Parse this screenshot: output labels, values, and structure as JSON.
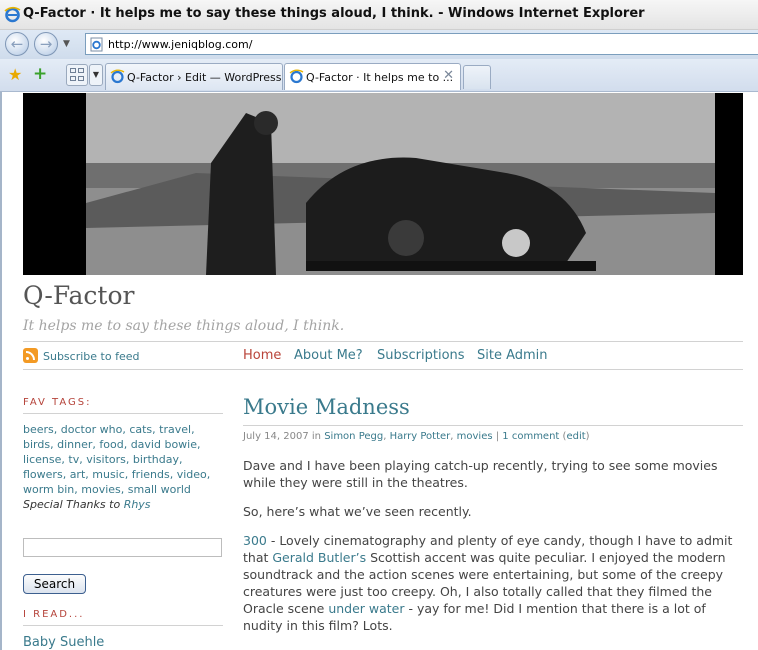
{
  "browser": {
    "window_title": "Q-Factor · It helps me to say these things aloud, I think. - Windows Internet Explorer",
    "address": "http://www.jeniqblog.com/",
    "tabs": [
      {
        "label": "Q-Factor › Edit — WordPress",
        "active": false
      },
      {
        "label": "Q-Factor · It helps me to ...",
        "active": true
      }
    ],
    "back_icon": "back-arrow-icon",
    "forward_icon": "forward-arrow-icon",
    "tab_close_icon": "close-icon"
  },
  "site": {
    "title": "Q-Factor",
    "description": "It helps me to say these things aloud, I think.",
    "feed_link": "Subscribe to feed"
  },
  "nav": [
    "Home",
    "About Me?",
    "Subscriptions",
    "Site Admin"
  ],
  "sidebar": {
    "fav_tags_heading": "FAV TAGS:",
    "tags": [
      "beers",
      "doctor who",
      "cats",
      "travel",
      "birds",
      "dinner",
      "food",
      "david bowie",
      "license",
      "tv",
      "visitors",
      "birthday",
      "flowers",
      "art",
      "music",
      "friends",
      "video",
      "worm bin",
      "movies",
      "small world"
    ],
    "thanks_text": "Special Thanks to",
    "thanks_name": "Rhys",
    "search_button": "Search",
    "i_read_heading": "I READ...",
    "blogroll": [
      "Baby Suehle"
    ]
  },
  "post": {
    "title": "Movie Madness",
    "date": "July 14, 2007 in",
    "categories": [
      "Simon Pegg",
      "Harry Potter",
      "movies"
    ],
    "comments": "1 comment",
    "edit": "edit",
    "p1": "Dave and I have been playing catch-up recently, trying to see some movies while they were still in the theatres.",
    "p2": "So, here’s what we’ve seen recently.",
    "p3_link1": "300",
    "p3_a": " - Lovely cinematography and plenty of eye candy, though I have to admit that ",
    "p3_link2": "Gerald Butler’s",
    "p3_b": " Scottish accent was quite peculiar. I enjoyed the modern soundtrack and the action scenes were entertaining, but some of the creepy creatures were just too creepy. Oh, I also totally called that they filmed the Oracle scene ",
    "p3_link3": "under water",
    "p3_c": " - yay for me! Did I mention that there is a lot of nudity in this film? Lots."
  },
  "colors": {
    "link": "#3a7a8c",
    "accent_red": "#b5433a",
    "text": "#444444"
  }
}
